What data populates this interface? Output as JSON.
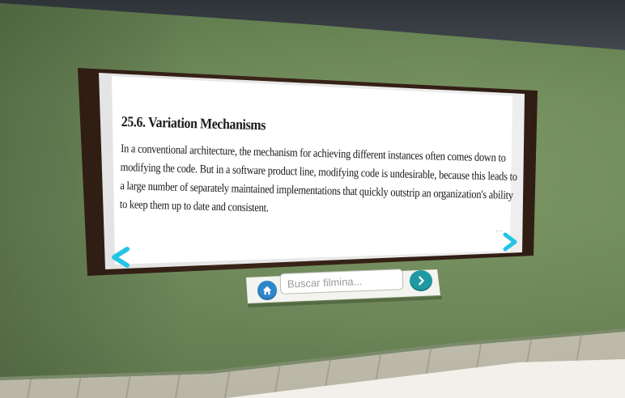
{
  "slide": {
    "title": "25.6. Variation Mechanisms",
    "lines": [
      "In a conventional architecture, the mechanism for achieving different instances often comes down to",
      "modifying the code. But in a software product line, modifying code is undesirable, because this leads to",
      "a large number of separately maintained implementations that quickly outstrip an organization's ability",
      "to keep them up to date and consistent."
    ],
    "dots": "..."
  },
  "navigation": {
    "prev_icon": "chevron-left-icon",
    "next_icon": "chevron-right-icon",
    "accent_color": "#23c4e6"
  },
  "search": {
    "placeholder": "Buscar filmina...",
    "value": "",
    "home_icon": "home-icon",
    "go_icon": "chevron-right-circle-icon",
    "home_color": "#2f86c9",
    "go_color": "#1f9aa3"
  }
}
